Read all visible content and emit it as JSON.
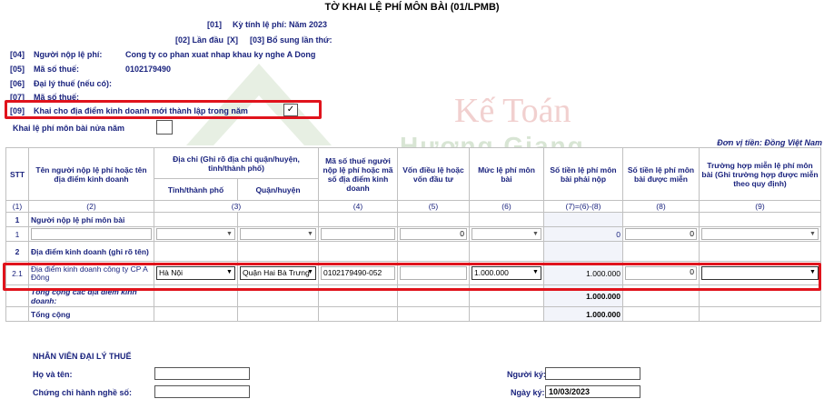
{
  "title": "TỜ KHAI LỆ PHÍ MÔN BÀI (01/LPMB)",
  "period": {
    "code": "[01]",
    "label": "Kỳ tính lệ phí: Năm 2023"
  },
  "first_time": {
    "code": "[02] Lần đầu",
    "mark": "[X]"
  },
  "supplement": {
    "code": "[03] Bổ sung lần thứ:"
  },
  "fields": [
    {
      "code": "[04]",
      "label": "Người nộp lệ phí:",
      "value": "Cong ty co phan xuat nhap khau ky nghe A Dong"
    },
    {
      "code": "[05]",
      "label": "Mã số thuế:",
      "value": "0102179490"
    },
    {
      "code": "[06]",
      "label": "Đại lý thuế (nếu có):",
      "value": ""
    },
    {
      "code": "[07]",
      "label": "Mã số thuế:",
      "value": ""
    }
  ],
  "new_location": {
    "code": "[09]",
    "label": "Khai cho địa điểm kinh doanh mới thành lập trong năm",
    "mark": "✓"
  },
  "half_year": {
    "label": "Khai lệ phí môn bài nửa năm",
    "mark": ""
  },
  "currency": "Đơn vị tiền: Đồng Việt Nam",
  "watermark": {
    "line1": "Kế Toán",
    "line2": "Hương Giang"
  },
  "table": {
    "headers": {
      "stt": "STT",
      "name": "Tên người nộp lệ phí hoặc tên địa điểm kinh doanh",
      "address": "Địa chỉ (Ghi rõ địa chỉ quận/huyện, tỉnh/thành phố)",
      "province": "Tỉnh/thành phố",
      "district": "Quận/huyện",
      "tax_code": "Mã số thuế người nộp lệ phí hoặc mã số địa điểm kinh doanh",
      "capital": "Vốn điều lệ hoặc vốn đầu tư",
      "rate": "Mức lệ phí môn bài",
      "payable": "Số tiền lệ phí môn bài phải nộp",
      "exempt": "Số tiền lệ phí môn bài được miễn",
      "exempt_case": "Trường hợp miễn lệ phí môn bài (Ghi trường hợp được miễn theo quy định)"
    },
    "index_row": [
      "(1)",
      "(2)",
      "(3)",
      "(4)",
      "(5)",
      "(6)",
      "(7)=(6)-(8)",
      "(8)",
      "(9)"
    ],
    "section1": {
      "stt": "1",
      "label": "Người nộp lệ phí môn bài"
    },
    "row1": {
      "stt": "1",
      "capital": "0",
      "rate": "",
      "payable": "0",
      "exempt": "0"
    },
    "section2": {
      "stt": "2",
      "label": "Địa điểm kinh doanh (ghi rõ tên)"
    },
    "row21": {
      "stt": "2.1",
      "name": "Địa điểm kinh doanh công ty CP A Đông",
      "province": "Hà Nội",
      "district": "Quận Hai Bà Trưng",
      "tax_code": "0102179490-052",
      "capital": "",
      "rate": "1.000.000",
      "payable": "1.000.000",
      "exempt": "0"
    },
    "subtotal": {
      "label": "Tổng cộng các địa điểm kinh doanh:",
      "payable": "1.000.000"
    },
    "total": {
      "label": "Tổng cộng",
      "payable": "1.000.000"
    }
  },
  "agent": {
    "title": "NHÂN VIÊN ĐẠI LÝ THUẾ",
    "name_label": "Họ và tên:",
    "name_value": "",
    "cert_label": "Chứng chỉ hành nghề số:",
    "cert_value": "",
    "signer_label": "Người ký:",
    "signer_value": "",
    "sign_date_label": "Ngày ký:",
    "sign_date_value": "10/03/2023"
  }
}
